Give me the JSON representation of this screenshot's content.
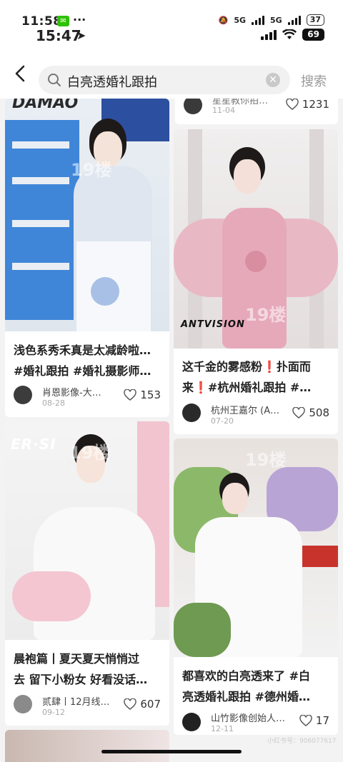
{
  "status": {
    "time_small": "11:58",
    "time_main": "15:47",
    "network_1": "5G",
    "network_2": "5G",
    "battery_small": "37",
    "battery_main": "69",
    "more": "···"
  },
  "search": {
    "query": "白亮透婚礼跟拍",
    "submit_label": "搜索"
  },
  "feed": {
    "partial_top": {
      "author": "星星教你拍…",
      "date": "11-04",
      "likes": "1231"
    },
    "cards": [
      {
        "title": "浅色系秀禾真是太减龄啦…\n#婚礼跟拍 #婚礼摄影师…",
        "author": "肖恩影像-大…",
        "date": "08-28",
        "likes": "153",
        "watermark": "19楼",
        "brand": "DAMAO"
      },
      {
        "title": "这千金的雾感粉❗扑面而\n来❗#杭州婚礼跟拍 #…",
        "author": "杭州王嘉尔 (A…",
        "date": "07-20",
        "likes": "508",
        "watermark": "19楼",
        "brand": "ANTVISION"
      },
      {
        "title": "晨袍篇丨夏天夏天悄悄过\n去 留下小粉女 好看没话…",
        "author": "贰肆丨12月线…",
        "date": "09-12",
        "likes": "607",
        "watermark": "19楼",
        "brand": "ER·SI"
      },
      {
        "title": "都喜欢的白亮透来了 #白\n亮透婚礼跟拍 #德州婚…",
        "author": "山竹影像创始人…",
        "date": "12-11",
        "likes": "17",
        "watermark": "19楼",
        "brand": ""
      }
    ]
  },
  "footer": {
    "faint_id": "小红书号：906077617"
  },
  "colors": {
    "accent_green": "#2dc100",
    "bg": "#f3f3f3",
    "pink": "#f2c7d2",
    "blue": "#4a8fd8"
  }
}
